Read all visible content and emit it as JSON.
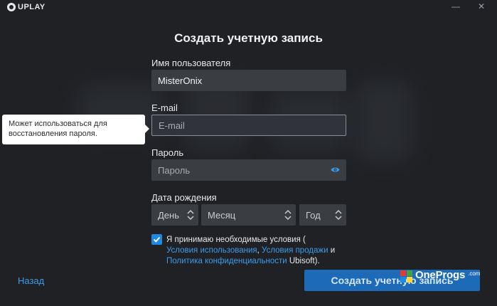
{
  "app": {
    "logo_text": "UPLAY",
    "minimize_glyph": "—",
    "close_glyph": "✕"
  },
  "form": {
    "title": "Создать учетную запись",
    "username": {
      "label": "Имя пользователя",
      "value": "MisterOnix"
    },
    "email": {
      "label": "E-mail",
      "value": "",
      "placeholder": "E-mail"
    },
    "password": {
      "label": "Пароль",
      "value": "",
      "placeholder": "Пароль",
      "icon": "eye-icon"
    },
    "birthdate": {
      "label": "Дата рождения",
      "day": "День",
      "month": "Месяц",
      "year": "Год"
    },
    "terms": {
      "checked": true,
      "prefix": "Я принимаю необходимые условия (",
      "link_terms_of_use": "Условия использования",
      "sep1": ", ",
      "link_terms_of_sale": "Условия продажи",
      "sep2": " и ",
      "link_privacy": "Политика конфиденциальности",
      "suffix": " Ubisoft)."
    }
  },
  "tooltip": {
    "text": "Может использоваться для восстановления пароля."
  },
  "footer": {
    "back_label": "Назад",
    "submit_label": "Создать учетную запись"
  },
  "watermark": {
    "text": "OneProgs",
    "suffix": ".com"
  },
  "colors": {
    "accent": "#1e88e5",
    "link": "#3d9be9",
    "button": "#1d6bb8",
    "background": "#1f2125",
    "field": "#3a3d42"
  }
}
